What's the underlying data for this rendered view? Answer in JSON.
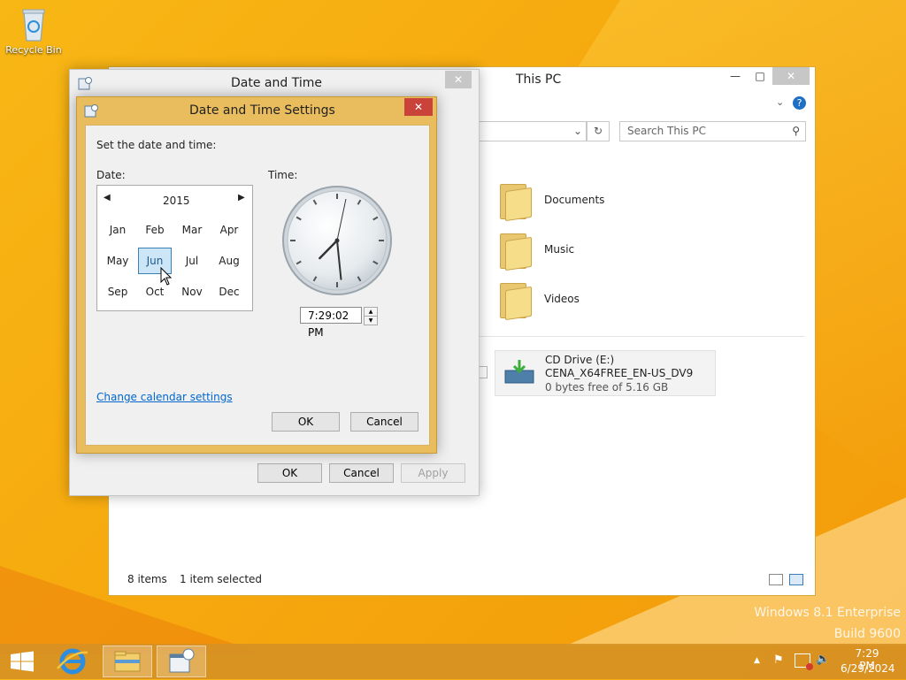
{
  "desktop": {
    "recycle_bin_label": "Recycle Bin",
    "watermark_line1": "Windows 8.1 Enterprise",
    "watermark_line2": "Build 9600"
  },
  "this_pc": {
    "title": "This PC",
    "search_placeholder": "Search This PC",
    "items": [
      {
        "label": "Documents",
        "icon": "documents-folder-icon"
      },
      {
        "label": "Music",
        "icon": "music-folder-icon"
      },
      {
        "label": "Videos",
        "icon": "videos-folder-icon"
      }
    ],
    "drive": {
      "name": "CD Drive (E:)",
      "volume": "CENA_X64FREE_EN-US_DV9",
      "space": "0 bytes free of 5.16 GB"
    },
    "status": {
      "items_count": "8 items",
      "selected": "1 item selected"
    }
  },
  "date_time_dialog": {
    "title": "Date and Time",
    "ok_label": "OK",
    "cancel_label": "Cancel",
    "apply_label": "Apply"
  },
  "date_time_settings": {
    "title": "Date and Time Settings",
    "instruction": "Set the date and time:",
    "date_label": "Date:",
    "time_label": "Time:",
    "year": "2015",
    "months": [
      "Jan",
      "Feb",
      "Mar",
      "Apr",
      "May",
      "Jun",
      "Jul",
      "Aug",
      "Sep",
      "Oct",
      "Nov",
      "Dec"
    ],
    "selected_month": "Jun",
    "time_value": "7:29:02 PM",
    "clock": {
      "hour": 7,
      "minute": 29,
      "second": 2
    },
    "change_calendar_link": "Change calendar settings",
    "ok_label": "OK",
    "cancel_label": "Cancel"
  },
  "taskbar": {
    "clock_time": "7:29 PM",
    "clock_date": "6/29/2024"
  },
  "colors": {
    "desktop_accent": "#f6a90e",
    "dialog_frame": "#e9bd5d",
    "close_button": "#c9433b",
    "link": "#0066cc",
    "selection": "#cde6f7"
  }
}
